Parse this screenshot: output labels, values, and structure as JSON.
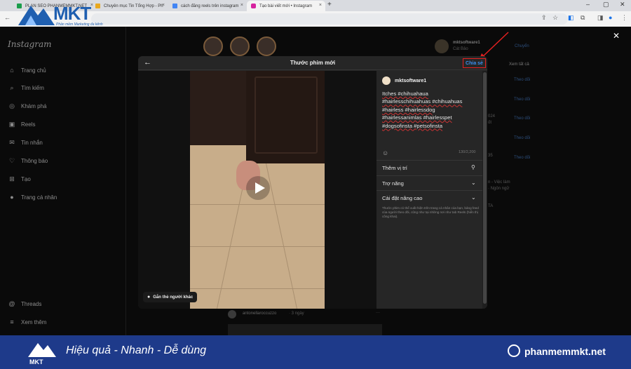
{
  "browser": {
    "tabs": [
      {
        "label": "PLAN SEO PHANMEMMKT.NET"
      },
      {
        "label": "Chuyên mục Tin Tổng Hợp - Ph"
      },
      {
        "label": "cách đăng reels trên instagram"
      },
      {
        "label": "Tạo bài viết mới • Instagram"
      }
    ],
    "new_tab": "+"
  },
  "watermark": {
    "brand": "MKT",
    "tagline": "Phần mềm Marketing đa kênh"
  },
  "sidebar": {
    "logo": "Instagram",
    "items": [
      {
        "label": "Trang chủ",
        "icon": "home-icon",
        "glyph": "⌂"
      },
      {
        "label": "Tìm kiếm",
        "icon": "search-icon",
        "glyph": "⌕"
      },
      {
        "label": "Khám phá",
        "icon": "compass-icon",
        "glyph": "◎"
      },
      {
        "label": "Reels",
        "icon": "reels-icon",
        "glyph": "▣"
      },
      {
        "label": "Tin nhắn",
        "icon": "messenger-icon",
        "glyph": "✉"
      },
      {
        "label": "Thông báo",
        "icon": "heart-icon",
        "glyph": "♡"
      },
      {
        "label": "Tạo",
        "icon": "create-icon",
        "glyph": "⊞"
      },
      {
        "label": "Trang cá nhân",
        "icon": "profile-icon",
        "glyph": "●"
      }
    ],
    "bottom": [
      {
        "label": "Threads",
        "icon": "threads-icon",
        "glyph": "@"
      },
      {
        "label": "Xem thêm",
        "icon": "menu-icon",
        "glyph": "≡"
      }
    ]
  },
  "rightcol": {
    "username": "mktsoftware1",
    "fullname": "Cát Bảo",
    "switch": "Chuyển",
    "see_all": "Xem tất cả",
    "follow": "Theo dõi",
    "frag_1": "024",
    "frag_2": "ốt",
    "frag_3": "35",
    "frag_4": "n - Việc làm",
    "frag_5": "· Ngôn ngữ",
    "frag_6": "TA"
  },
  "feed_behind": {
    "username": "antonellaroccuzzo",
    "time": "· 3 ngày",
    "more": "···"
  },
  "modal": {
    "title": "Thước phim mới",
    "share_label": "Chia sẻ",
    "tag_people": "Gắn thẻ người khác",
    "username": "mktsoftware1",
    "caption_lines": [
      {
        "text": "Itches #chihuahaua",
        "underline": true
      },
      {
        "text": "#hairlesschihuahuas #chihuahuas",
        "underline": true
      },
      {
        "text": "#hairless #hairlessdog",
        "underline": true
      },
      {
        "text": "#hairlessanimlas #hairlesspet",
        "underline": true
      },
      {
        "text": "#dogsofinsta #petsofinsta",
        "underline": true
      }
    ],
    "char_count": "130/2,200",
    "location_label": "Thêm vị trí",
    "accessibility_label": "Trợ năng",
    "advanced_label": "Cài đặt nâng cao",
    "note": "Thước phim có thể xuất hiện trên trang cá nhân của bạn, bảng feed của người theo dõi, cũng như tại những nơi như tab Reels (hiển thị công khai)."
  },
  "banner": {
    "slogan": "Hiệu quả - Nhanh - Dễ dùng",
    "site": "phanmemmkt.net"
  },
  "colors": {
    "accent_link": "#3a8ff0",
    "highlight_box": "#e52020",
    "banner_bg": "#1e3a8a"
  }
}
